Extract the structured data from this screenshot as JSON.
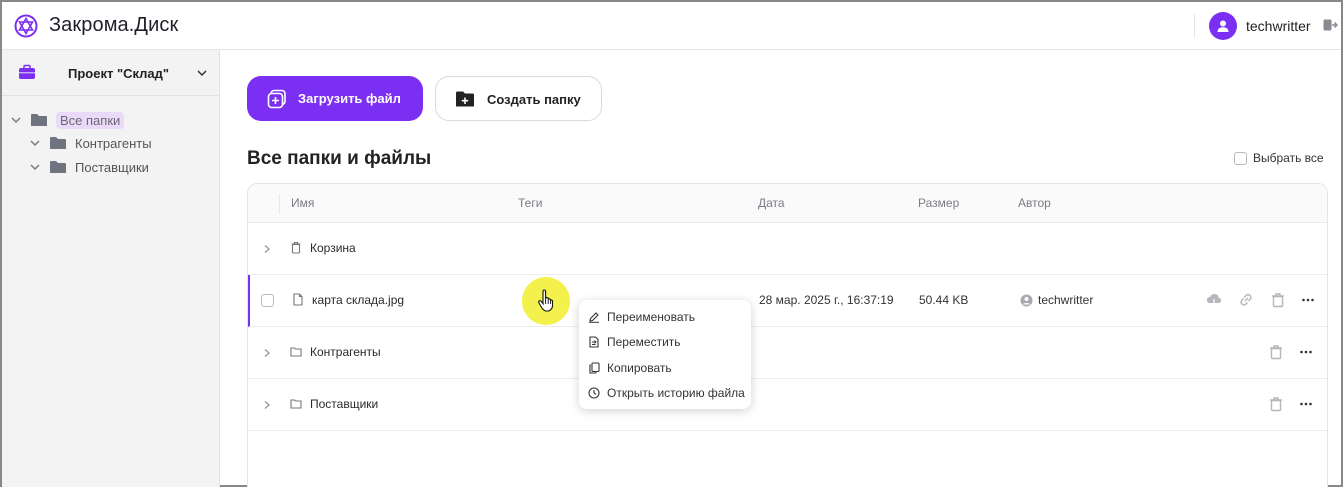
{
  "app": {
    "title": "Закрома.Диск"
  },
  "user": {
    "name": "techwritter"
  },
  "colors": {
    "accent": "#7b2ff2",
    "tree_highlight": "#ead9f8",
    "cursor_halo": "#f4f14d"
  },
  "sidebar": {
    "project": "Проект \"Склад\"",
    "tree": [
      {
        "label": "Все папки",
        "active": true
      },
      {
        "label": "Контрагенты"
      },
      {
        "label": "Поставщики"
      }
    ]
  },
  "toolbar": {
    "upload_label": "Загрузить файл",
    "create_folder_label": "Создать папку"
  },
  "main": {
    "title": "Все папки и файлы",
    "select_all_label": "Выбрать все"
  },
  "table": {
    "headers": {
      "name": "Имя",
      "tags": "Теги",
      "date": "Дата",
      "size": "Размер",
      "author": "Автор"
    },
    "rows": [
      {
        "type": "trash",
        "name": "Корзина"
      },
      {
        "type": "file",
        "name": "карта склада.jpg",
        "date": "28 мар. 2025 г., 16:37:19",
        "size": "50.44 KB",
        "author": "techwritter"
      },
      {
        "type": "folder",
        "name": "Контрагенты"
      },
      {
        "type": "folder",
        "name": "Поставщики"
      }
    ]
  },
  "context_menu": {
    "items": [
      {
        "label": "Переименовать",
        "icon": "pencil-icon"
      },
      {
        "label": "Переместить",
        "icon": "move-document-icon"
      },
      {
        "label": "Копировать",
        "icon": "copy-icon"
      },
      {
        "label": "Открыть историю файла",
        "icon": "clock-icon"
      }
    ]
  }
}
